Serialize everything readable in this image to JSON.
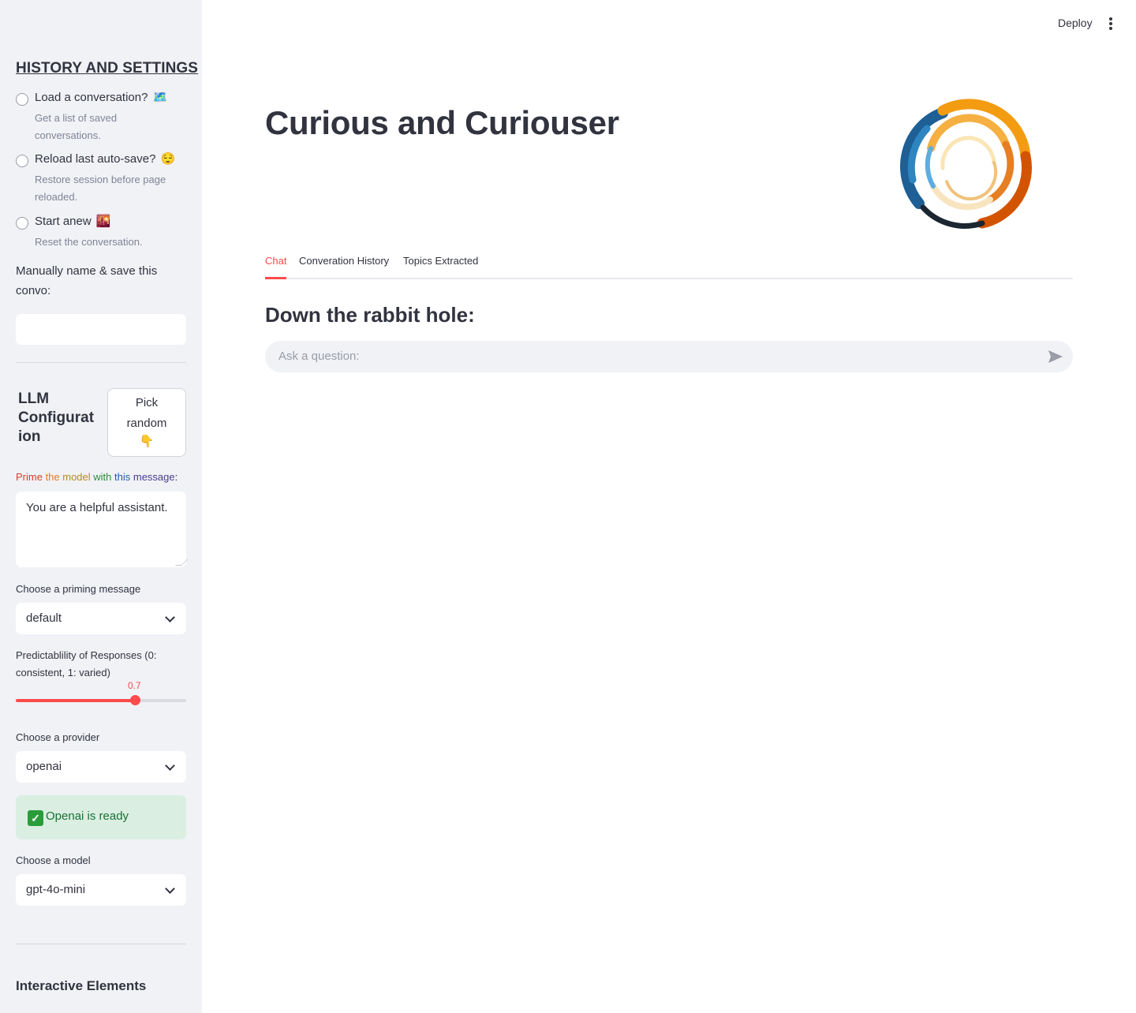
{
  "sidebar": {
    "title": "HISTORY AND SETTINGS",
    "radios": [
      {
        "label": "Load a conversation?",
        "emoji": "🗺️",
        "help": "Get a list of saved conversations."
      },
      {
        "label": "Reload last auto-save?",
        "emoji": "😌",
        "help": "Restore session before page reloaded."
      },
      {
        "label": "Start anew",
        "emoji": "🌇",
        "help": "Reset the conversation."
      }
    ],
    "save_label": "Manually name & save this convo:",
    "save_value": "",
    "llm_title": "LLM Configurat ion",
    "pick_button": {
      "line1": "Pick",
      "line2": "random",
      "emoji": "👇"
    },
    "prime_label_words": [
      {
        "text": "Prime ",
        "color": "#e0392b"
      },
      {
        "text": "the ",
        "color": "#ea7a21"
      },
      {
        "text": "model ",
        "color": "#b68d18"
      },
      {
        "text": "with ",
        "color": "#2f8c3c"
      },
      {
        "text": "this ",
        "color": "#2a57b5"
      },
      {
        "text": "message",
        "color": "#4a3a92"
      },
      {
        "text": ":",
        "color": "#31333f"
      }
    ],
    "prime_value": "You are a helpful assistant.",
    "priming_select": {
      "label": "Choose a priming message",
      "value": "default"
    },
    "slider": {
      "label": "Predictablility of Responses (0: consistent, 1: varied)",
      "value": "0.7",
      "fraction": 0.7
    },
    "provider_select": {
      "label": "Choose a provider",
      "value": "openai"
    },
    "ready_message": "Openai is ready",
    "model_select": {
      "label": "Choose a model",
      "value": "gpt-4o-mini"
    },
    "interactive_title": "Interactive Elements"
  },
  "header": {
    "deploy_label": "Deploy"
  },
  "main": {
    "title": "Curious and Curiouser",
    "tabs": [
      {
        "label": "Chat",
        "active": true
      },
      {
        "label": "Converation History",
        "active": false
      },
      {
        "label": "Topics Extracted",
        "active": false
      }
    ],
    "sub_heading": "Down the rabbit hole:",
    "chat_placeholder": "Ask a question:"
  },
  "colors": {
    "accent": "#ff4b4b",
    "sidebar_bg": "#f0f2f6",
    "success_bg": "#dbeee2",
    "success_text": "#177233"
  }
}
